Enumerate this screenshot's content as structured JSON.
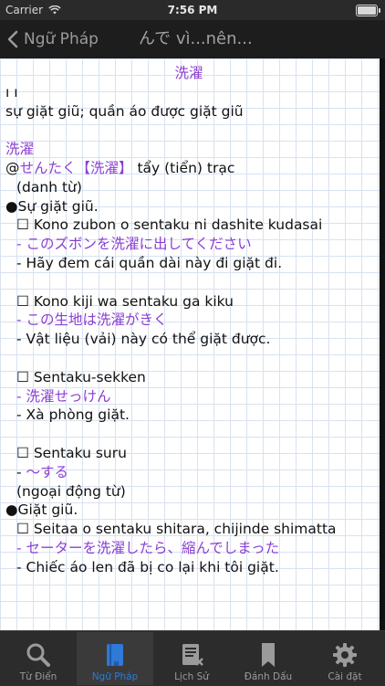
{
  "status_bar": {
    "carrier": "Carrier",
    "time": "7:56 PM"
  },
  "nav_bar": {
    "back_label": "Ngữ Pháp",
    "title": "んで vì...nên..."
  },
  "entry": {
    "title": "洗濯",
    "lines": [
      {
        "text": "ı ı",
        "style": "normal"
      },
      {
        "text": "sự giặt giũ; quần áo được giặt giũ",
        "style": "normal"
      },
      {
        "text": "",
        "style": "blank"
      },
      {
        "text": "洗濯",
        "style": "purple"
      },
      {
        "text_parts": [
          "@",
          "せんたく【洗濯】",
          "tẩy (tiển) trạc"
        ],
        "style": "mixed"
      },
      {
        "text": "(danh từ)",
        "style": "indent"
      },
      {
        "text": "●Sự giặt giũ.",
        "style": "normal"
      },
      {
        "text": "☐ Kono zubon o sentaku ni dashite kudasai",
        "style": "indent"
      },
      {
        "text": "- このズボンを洗濯に出してください",
        "style": "indent-purple"
      },
      {
        "text": "- Hãy đem cái quần dài này đi giặt đi.",
        "style": "indent"
      },
      {
        "text": "",
        "style": "blank"
      },
      {
        "text": "☐ Kono kiji wa sentaku ga kiku",
        "style": "indent"
      },
      {
        "text": "- この生地は洗濯がきく",
        "style": "indent-purple"
      },
      {
        "text": "- Vật liệu (vải) này có thể giặt được.",
        "style": "indent"
      },
      {
        "text": "",
        "style": "blank"
      },
      {
        "text": "☐ Sentaku-sekken",
        "style": "indent"
      },
      {
        "text": "- 洗濯せっけん",
        "style": "indent-purple"
      },
      {
        "text": "- Xà phòng giặt.",
        "style": "indent"
      },
      {
        "text": "",
        "style": "blank"
      },
      {
        "text": "☐ Sentaku suru",
        "style": "indent"
      },
      {
        "text_parts": [
          "- ",
          "～する"
        ],
        "style": "indent-mixed"
      },
      {
        "text": "(ngoại động từ)",
        "style": "indent"
      },
      {
        "text": "●Giặt giũ.",
        "style": "normal"
      },
      {
        "text": "☐ Seitaa o sentaku shitara, chijinde shimatta",
        "style": "indent"
      },
      {
        "text": "- セーターを洗濯したら、縮んでしまった",
        "style": "indent-purple"
      },
      {
        "text": "- Chiếc áo len đã bị co lại khi tôi giặt.",
        "style": "indent"
      }
    ]
  },
  "tabs": [
    {
      "label": "Từ Điển",
      "icon": "search-icon"
    },
    {
      "label": "Ngữ Pháp",
      "icon": "book-icon",
      "active": true
    },
    {
      "label": "Lịch Sử",
      "icon": "history-icon"
    },
    {
      "label": "Đánh Dấu",
      "icon": "bookmark-icon"
    },
    {
      "label": "Cài đặt",
      "icon": "gear-icon"
    }
  ],
  "colors": {
    "accent": "#2f7ad8",
    "purple": "#8a3fd3",
    "nav_bg": "#1d1d1d",
    "tab_bg": "#2c2c2c"
  }
}
